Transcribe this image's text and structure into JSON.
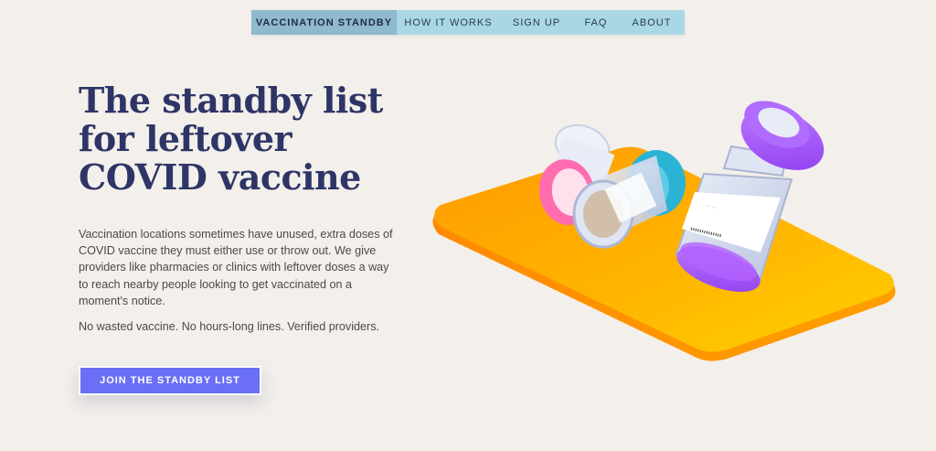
{
  "nav": {
    "brand": "VACCINATION STANDBY",
    "items": [
      {
        "label": "HOW IT WORKS"
      },
      {
        "label": "SIGN UP"
      },
      {
        "label": "FAQ"
      },
      {
        "label": "ABOUT"
      }
    ]
  },
  "hero": {
    "title_line1": "The standby list",
    "title_line2": "for leftover",
    "title_line3": "COVID vaccine",
    "description": "Vaccination locations sometimes have unused, extra doses of COVID vaccine they must either use or throw out. We give providers like pharmacies or clinics with leftover doses a way to reach nearby people looking to get vaccinated on a moment's notice.",
    "tagline": "No wasted vaccine. No hours-long lines. Verified providers.",
    "cta_label": "JOIN THE STANDBY LIST"
  },
  "colors": {
    "background": "#f3efeb",
    "nav_bg": "#a9d7e6",
    "nav_active_bg": "#8fb9cc",
    "title": "#2e3566",
    "cta": "#6a6ff5",
    "tray": "#ffb000",
    "cap_pink": "#ff5fa8",
    "cap_teal": "#2bb3d6",
    "cap_purple": "#a855f7"
  }
}
